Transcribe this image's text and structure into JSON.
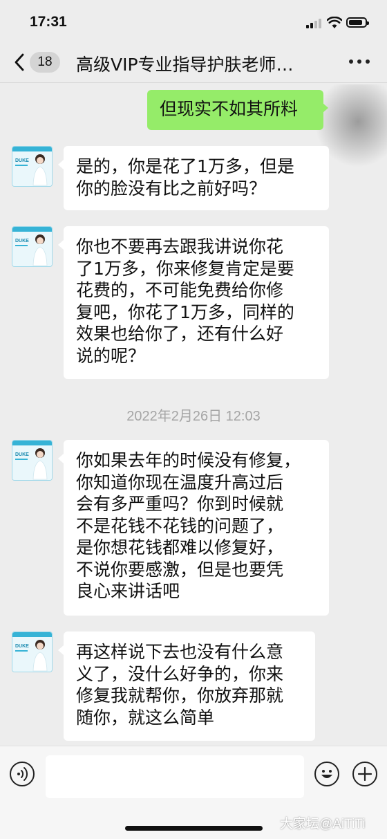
{
  "status_bar": {
    "time": "17:31"
  },
  "header": {
    "unread_count": "18",
    "title": "高级VIP专业指导护肤老师…"
  },
  "messages": [
    {
      "side": "out",
      "text": "但现实不如其所料"
    },
    {
      "side": "in",
      "text": "是的，你是花了1万多，但是\n你的脸没有比之前好吗？"
    },
    {
      "side": "in",
      "text": "你也不要再去跟我讲说你花\n了1万多，你来修复肯定是要\n花费的，不可能免费给你修\n复吧，你花了1万多，同样的\n效果也给你了，还有什么好\n说的呢？"
    },
    {
      "side": "in",
      "text": "你如果去年的时候没有修复，\n你知道你现在温度升高过后\n会有多严重吗？你到时候就\n不是花钱不花钱的问题了，\n是你想花钱都难以修复好，\n不说你要感激，但是也要凭\n良心来讲话吧"
    },
    {
      "side": "in",
      "text": "再这样说下去也没有什么意\n义了，没什么好争的，你来\n修复我就帮你，你放弃那就\n随你，就这么简单"
    }
  ],
  "timestamp": "2022年2月26日 12:03",
  "avatar": {
    "brand": "DUKE",
    "caption": "美肤护理专家"
  },
  "watermark": "大家坛@AiTiTi",
  "colors": {
    "outgoing": "#95ec69",
    "incoming": "#ffffff",
    "background": "#ededed"
  }
}
